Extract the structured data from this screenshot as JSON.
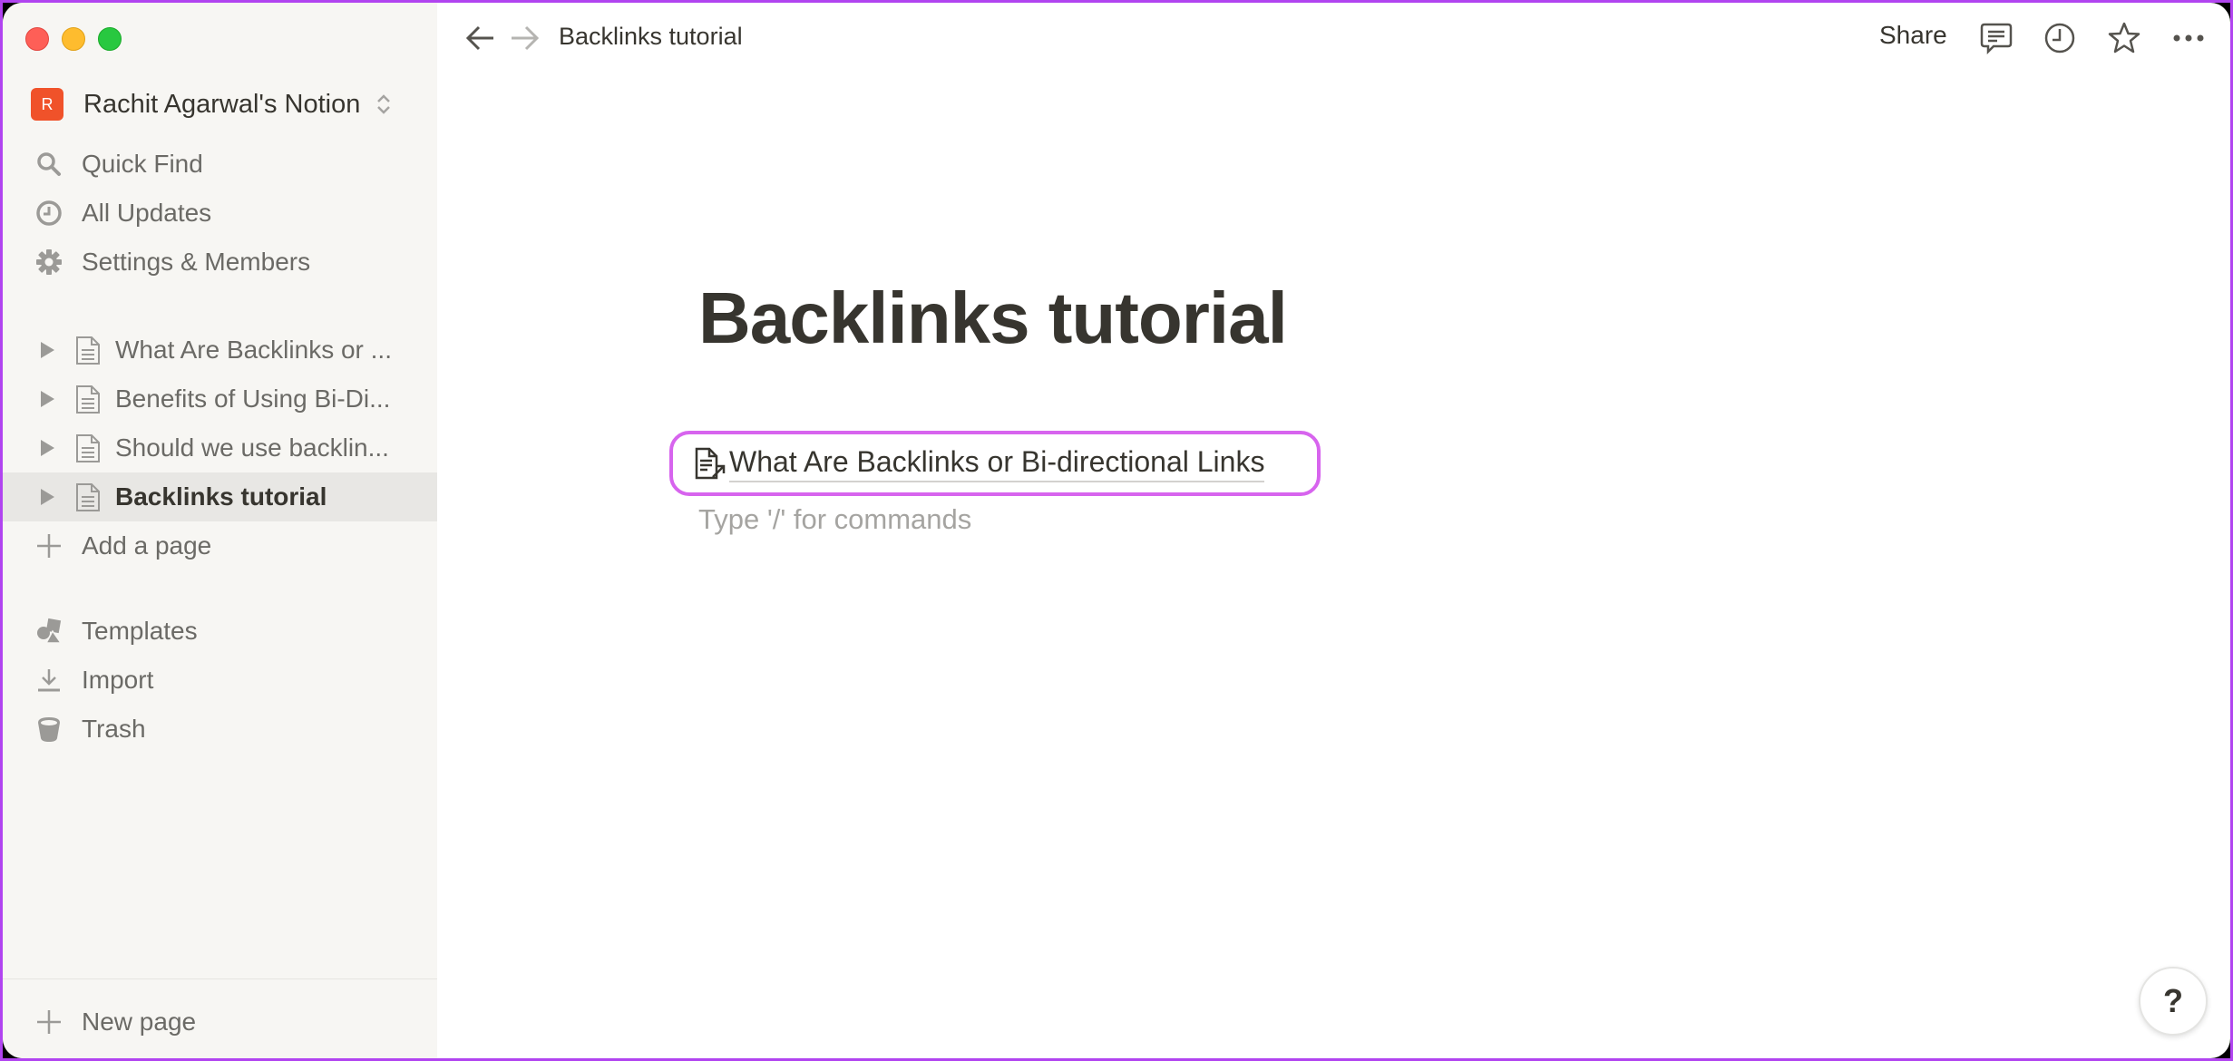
{
  "window": {
    "breadcrumb": "Backlinks tutorial",
    "accent_highlight": "#d764ee"
  },
  "sidebar": {
    "workspace": {
      "avatar_letter": "R",
      "name": "Rachit Agarwal's Notion",
      "avatar_color": "#f0522a"
    },
    "nav": [
      {
        "label": "Quick Find",
        "icon": "search-icon"
      },
      {
        "label": "All Updates",
        "icon": "clock-icon"
      },
      {
        "label": "Settings & Members",
        "icon": "gear-icon"
      }
    ],
    "pages": [
      {
        "label": "What Are Backlinks or ...",
        "active": false
      },
      {
        "label": "Benefits of Using Bi-Di...",
        "active": false
      },
      {
        "label": "Should we use backlin...",
        "active": false
      },
      {
        "label": "Backlinks tutorial",
        "active": true
      }
    ],
    "add_page": "Add a page",
    "tools": [
      {
        "label": "Templates",
        "icon": "templates-icon"
      },
      {
        "label": "Import",
        "icon": "import-icon"
      },
      {
        "label": "Trash",
        "icon": "trash-icon"
      }
    ],
    "new_page": "New page"
  },
  "topbar": {
    "share_label": "Share",
    "icons": [
      "comment-icon",
      "history-clock-icon",
      "favorite-star-icon",
      "more-icon"
    ]
  },
  "page": {
    "title": "Backlinks tutorial",
    "link_to_page": "What Are Backlinks or Bi-directional Links",
    "placeholder": "Type '/' for commands"
  },
  "help": {
    "label": "?"
  }
}
